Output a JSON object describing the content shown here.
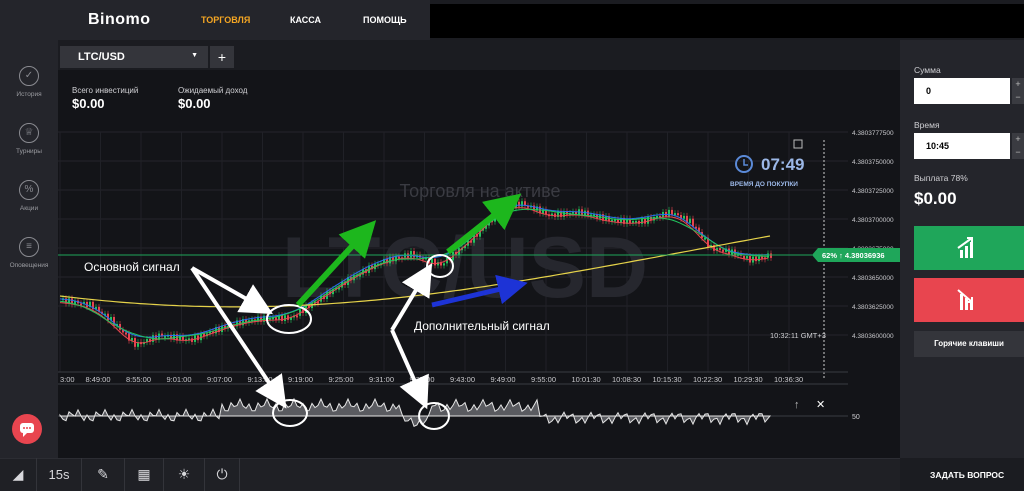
{
  "header": {
    "logo": "Binomo",
    "nav": [
      "ТОРГОВЛЯ",
      "КАССА",
      "ПОМОЩЬ"
    ],
    "active_color": "#f5a623"
  },
  "sidebar": [
    {
      "label": "История",
      "icon": "check-circle-icon"
    },
    {
      "label": "Турниры",
      "icon": "trophy-icon"
    },
    {
      "label": "Акции",
      "icon": "percent-icon"
    },
    {
      "label": "Оповещения",
      "icon": "bell-lines-icon"
    }
  ],
  "tab": {
    "asset": "LTC/USD",
    "add": "+"
  },
  "stats": {
    "investments_label": "Всего инвестиций",
    "investments_value": "$0.00",
    "income_label": "Ожидаемый доход",
    "income_value": "$0.00"
  },
  "chart": {
    "watermark_small": "Торговля на активе",
    "watermark_big": "LTC/USD",
    "timer": "07:49",
    "timer_label": "ВРЕМЯ ДО ПОКУПКИ",
    "price_badge": "62% ↑ 4.38036936",
    "clock": "10:32:11 GMT+3",
    "price_ticks": [
      "4.3803777500",
      "4.3803750000",
      "4.3803725000",
      "4.3803700000",
      "4.3803675000",
      "4.3803650000",
      "4.3803625000",
      "4.3803600000"
    ],
    "time_ticks": [
      "3:00",
      "8:49:00",
      "8:55:00",
      "9:01:00",
      "9:07:00",
      "9:13:00",
      "9:19:00",
      "9:25:00",
      "9:31:00",
      "9:37:00",
      "9:43:00",
      "9:49:00",
      "9:55:00",
      "10:01:30",
      "10:08:30",
      "10:15:30",
      "10:22:30",
      "10:29:30",
      "10:36:30"
    ],
    "indicator_level": "50",
    "annotation_main": "Основной сигнал",
    "annotation_extra": "Дополнительный сигнал",
    "colors": {
      "up": "#22c55e",
      "down": "#e8454f",
      "ma_yellow": "#e6d34a",
      "arrow_green": "#1db71d",
      "arrow_blue": "#1d33d6"
    }
  },
  "trade_panel": {
    "amount_label": "Сумма",
    "amount_value": "0",
    "time_label": "Время",
    "time_value": "10:45",
    "payout_label": "Выплата 78%",
    "payout_value": "$0.00",
    "hotkeys": "Горячие клавиши",
    "step_plus": "+",
    "step_minus": "−"
  },
  "bottom": {
    "timeframe": "15s",
    "ask": "ЗАДАТЬ ВОПРОС"
  }
}
